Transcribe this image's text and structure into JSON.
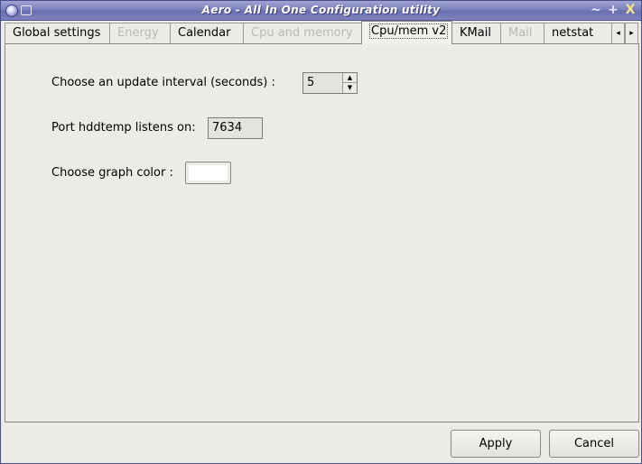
{
  "window": {
    "title": "Aero - All In One Configuration utility",
    "buttons": {
      "minimize": "~",
      "maximize": "+",
      "close": "X"
    }
  },
  "tabs": [
    {
      "label": "Global settings",
      "state": "normal"
    },
    {
      "label": "Energy",
      "state": "disabled"
    },
    {
      "label": "Calendar",
      "state": "normal"
    },
    {
      "label": "Cpu and memory",
      "state": "disabled"
    },
    {
      "label": "Cpu/mem v2",
      "state": "active"
    },
    {
      "label": "KMail",
      "state": "normal"
    },
    {
      "label": "Mail",
      "state": "disabled"
    },
    {
      "label": "netstat",
      "state": "normal"
    }
  ],
  "tab_scroll": {
    "left": "◂",
    "right": "▸"
  },
  "form": {
    "update_interval_label": "Choose an update interval (seconds) :",
    "update_interval_value": "5",
    "spin_up": "▲",
    "spin_down": "▼",
    "port_label": "Port hddtemp listens on:",
    "port_value": "7634",
    "graph_color_label": "Choose graph color :",
    "graph_color_value": "#ffffff"
  },
  "footer": {
    "apply_label": "Apply",
    "cancel_label": "Cancel"
  }
}
